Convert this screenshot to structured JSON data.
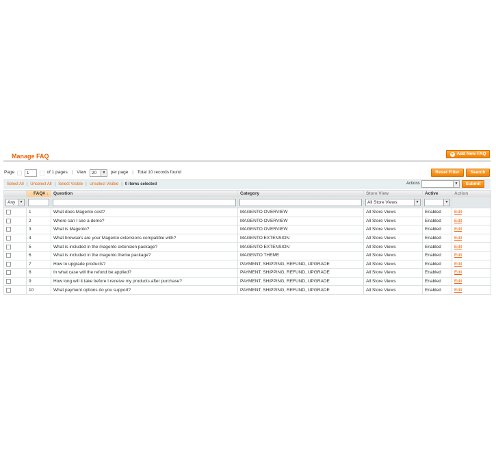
{
  "header": {
    "title": "Manage FAQ",
    "add_button_label": "Add New FAQ"
  },
  "pager": {
    "page_label": "Page",
    "page_value": "1",
    "of_pages": "of 1 pages",
    "view_label": "View",
    "per_page_value": "20",
    "per_page_label": "per page",
    "records_found": "Total 10 records found",
    "reset_filter_label": "Reset Filter",
    "search_label": "Search"
  },
  "massaction": {
    "select_all": "Select All",
    "unselect_all": "Unselect All",
    "select_visible": "Select Visible",
    "unselect_visible": "Unselect Visible",
    "items_selected": "0 items selected",
    "actions_label": "Actions",
    "submit_label": "Submit"
  },
  "grid": {
    "columns": {
      "id": "FAQ#",
      "question": "Question",
      "category": "Category",
      "store_view": "Store View",
      "active": "Active",
      "action": "Action"
    },
    "filters": {
      "checkbox_select": "Any",
      "store_view_select": "All Store Views"
    },
    "rows": [
      {
        "id": "1",
        "question": "What does Magento cost?",
        "category": "MAGENTO OVERVIEW",
        "store_view": "All Store Views",
        "active": "Enabled",
        "action": "Edit"
      },
      {
        "id": "2",
        "question": "Where can I see a demo?",
        "category": "MAGENTO OVERVIEW",
        "store_view": "All Store Views",
        "active": "Enabled",
        "action": "Edit"
      },
      {
        "id": "3",
        "question": "What is Magento?",
        "category": "MAGENTO OVERVIEW",
        "store_view": "All Store Views",
        "active": "Enabled",
        "action": "Edit"
      },
      {
        "id": "4",
        "question": "What browsers are your Magento extensions compatible with?",
        "category": "MAGENTO EXTENSION",
        "store_view": "All Store Views",
        "active": "Enabled",
        "action": "Edit"
      },
      {
        "id": "5",
        "question": "What is included in the magento extension package?",
        "category": "MAGENTO EXTENSION",
        "store_view": "All Store Views",
        "active": "Enabled",
        "action": "Edit"
      },
      {
        "id": "6",
        "question": "What is included in the magento theme package?",
        "category": "MAGENTO THEME",
        "store_view": "All Store Views",
        "active": "Enabled",
        "action": "Edit"
      },
      {
        "id": "7",
        "question": "How to upgrade products?",
        "category": "PAYMENT, SHIPPING, REFUND, UPGRADE",
        "store_view": "All Store Views",
        "active": "Enabled",
        "action": "Edit"
      },
      {
        "id": "8",
        "question": "In what case will the refund be applied?",
        "category": "PAYMENT, SHIPPING, REFUND, UPGRADE",
        "store_view": "All Store Views",
        "active": "Enabled",
        "action": "Edit"
      },
      {
        "id": "9",
        "question": "How long will it take before I receive my products after purchase?",
        "category": "PAYMENT, SHIPPING, REFUND, UPGRADE",
        "store_view": "All Store Views",
        "active": "Enabled",
        "action": "Edit"
      },
      {
        "id": "10",
        "question": "What payment options do you support?",
        "category": "PAYMENT, SHIPPING, REFUND, UPGRADE",
        "store_view": "All Store Views",
        "active": "Enabled",
        "action": "Edit"
      }
    ]
  },
  "colors": {
    "accent": "#eb5e00",
    "button": "#f18200"
  }
}
